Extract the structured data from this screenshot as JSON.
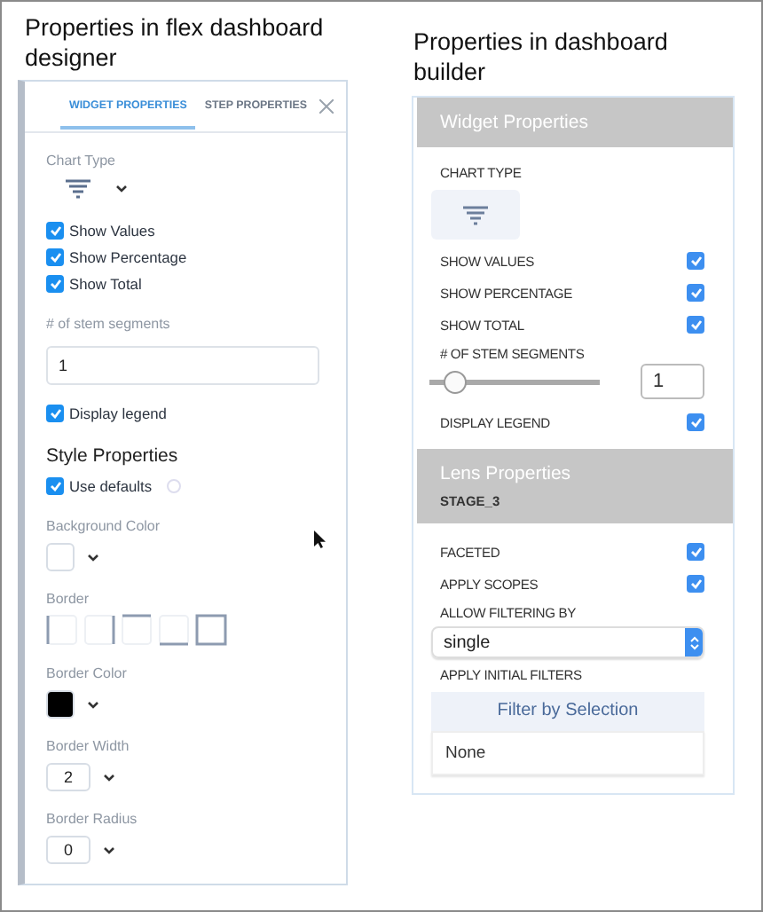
{
  "designer": {
    "title": "Properties in flex dashboard designer",
    "tabs": [
      {
        "label": "WIDGET PROPERTIES",
        "selected": true
      },
      {
        "label": "STEP PROPERTIES",
        "selected": false
      }
    ],
    "chart_type_label": "Chart Type",
    "options": [
      {
        "label": "Show Values",
        "checked": true
      },
      {
        "label": "Show Percentage",
        "checked": true
      },
      {
        "label": "Show Total",
        "checked": true
      }
    ],
    "stem_segments": {
      "label": "# of stem segments",
      "value": "1"
    },
    "display_legend": {
      "label": "Display legend",
      "checked": true
    },
    "style_title": "Style Properties",
    "use_defaults": {
      "label": "Use defaults",
      "checked": true
    },
    "fields": [
      {
        "kind": "color",
        "label": "Background Color",
        "color": "#ffffff"
      },
      {
        "kind": "border",
        "label": "Border"
      },
      {
        "kind": "color",
        "label": "Border Color",
        "color": "#000000"
      },
      {
        "kind": "number",
        "label": "Border Width",
        "value": "2"
      },
      {
        "kind": "number",
        "label": "Border Radius",
        "value": "0"
      }
    ]
  },
  "builder": {
    "title": "Properties in dashboard builder",
    "widget": {
      "header": "Widget Properties",
      "chart_type_label": "CHART TYPE",
      "options": [
        {
          "label": "SHOW VALUES",
          "checked": true
        },
        {
          "label": "SHOW PERCENTAGE",
          "checked": true
        },
        {
          "label": "SHOW TOTAL",
          "checked": true
        }
      ],
      "stem_segments": {
        "label": "# OF STEM SEGMENTS",
        "level": 0.15,
        "value": "1"
      },
      "display_legend": {
        "label": "DISPLAY LEGEND",
        "checked": true
      }
    },
    "lens": {
      "header": "Lens Properties",
      "subheader": "STAGE_3",
      "options": [
        {
          "label": "FACETED",
          "checked": true
        },
        {
          "label": "APPLY SCOPES",
          "checked": true
        }
      ],
      "filtering": {
        "label": "ALLOW FILTERING BY",
        "value": "single"
      },
      "initial_filters": {
        "label": "APPLY INITIAL FILTERS",
        "button": "Filter by Selection",
        "value": "None"
      }
    }
  }
}
